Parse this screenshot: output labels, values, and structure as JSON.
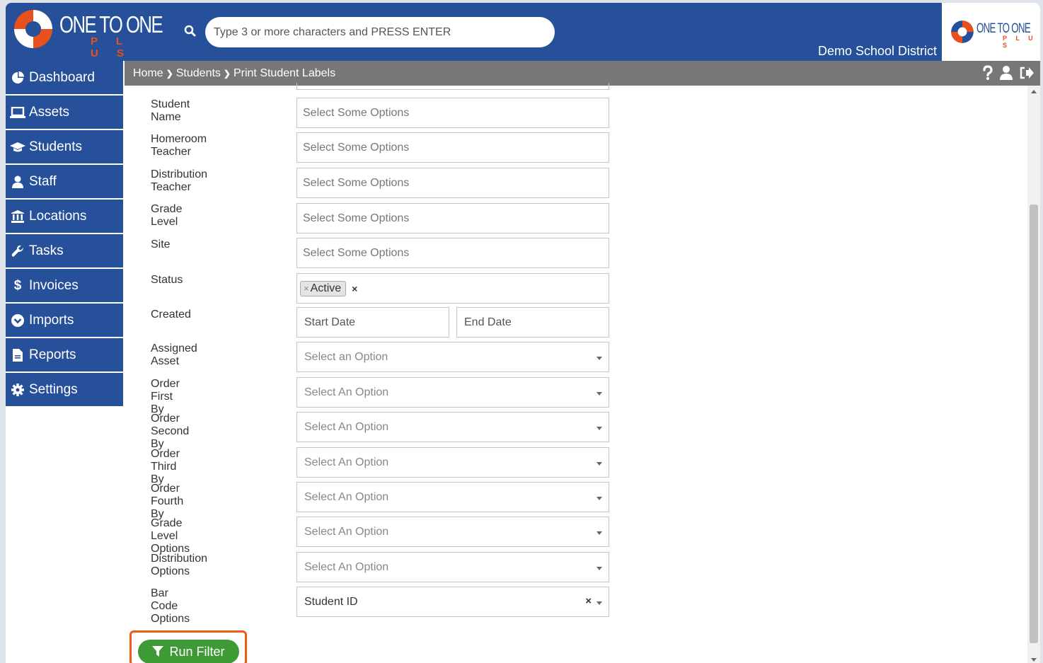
{
  "app": {
    "logo_text": "ONE TO ONE",
    "logo_sub": "P L U S",
    "district": "Demo School District"
  },
  "search": {
    "placeholder": "Type 3 or more characters and PRESS ENTER"
  },
  "breadcrumb": {
    "items": [
      "Home",
      "Students",
      "Print Student Labels"
    ]
  },
  "sidebar": {
    "items": [
      {
        "label": "Dashboard",
        "icon": "dashboard-icon"
      },
      {
        "label": "Assets",
        "icon": "laptop-icon"
      },
      {
        "label": "Students",
        "icon": "graduation-cap-icon"
      },
      {
        "label": "Staff",
        "icon": "user-icon"
      },
      {
        "label": "Locations",
        "icon": "building-icon"
      },
      {
        "label": "Tasks",
        "icon": "wrench-icon"
      },
      {
        "label": "Invoices",
        "icon": "dollar-icon"
      },
      {
        "label": "Imports",
        "icon": "circle-chevron-down-icon"
      },
      {
        "label": "Reports",
        "icon": "file-icon"
      },
      {
        "label": "Settings",
        "icon": "cog-icon"
      }
    ]
  },
  "form": {
    "student_name": {
      "label": "Student Name",
      "placeholder": "Select Some Options"
    },
    "homeroom_teacher": {
      "label": "Homeroom Teacher",
      "placeholder": "Select Some Options"
    },
    "distribution_teacher": {
      "label": "Distribution Teacher",
      "placeholder": "Select Some Options"
    },
    "grade_level": {
      "label": "Grade Level",
      "placeholder": "Select Some Options"
    },
    "site": {
      "label": "Site",
      "placeholder": "Select Some Options"
    },
    "status": {
      "label": "Status",
      "chip": "Active",
      "chip_x": "×",
      "clear": "×"
    },
    "created": {
      "label": "Created",
      "start": "Start Date",
      "end": "End Date"
    },
    "assigned_asset": {
      "label": "Assigned Asset",
      "value": "Select an Option"
    },
    "order_first": {
      "label": "Order First By",
      "value": "Select An Option"
    },
    "order_second": {
      "label": "Order Second By",
      "value": "Select An Option"
    },
    "order_third": {
      "label": "Order Third By",
      "value": "Select An Option"
    },
    "order_fourth": {
      "label": "Order Fourth By",
      "value": "Select An Option"
    },
    "grade_level_options": {
      "label": "Grade Level Options",
      "value": "Select An Option"
    },
    "distribution_options": {
      "label": "Distribution Options",
      "value": "Select An Option"
    },
    "bar_code_options": {
      "label": "Bar Code Options",
      "value": "Student ID",
      "clear": "×"
    }
  },
  "actions": {
    "run_filter": "Run Filter"
  },
  "colors": {
    "header": "#26509a",
    "breadcrumb": "#777777",
    "accent": "#e8501e",
    "run_button": "#3e9a35",
    "highlight": "#f05a13"
  }
}
